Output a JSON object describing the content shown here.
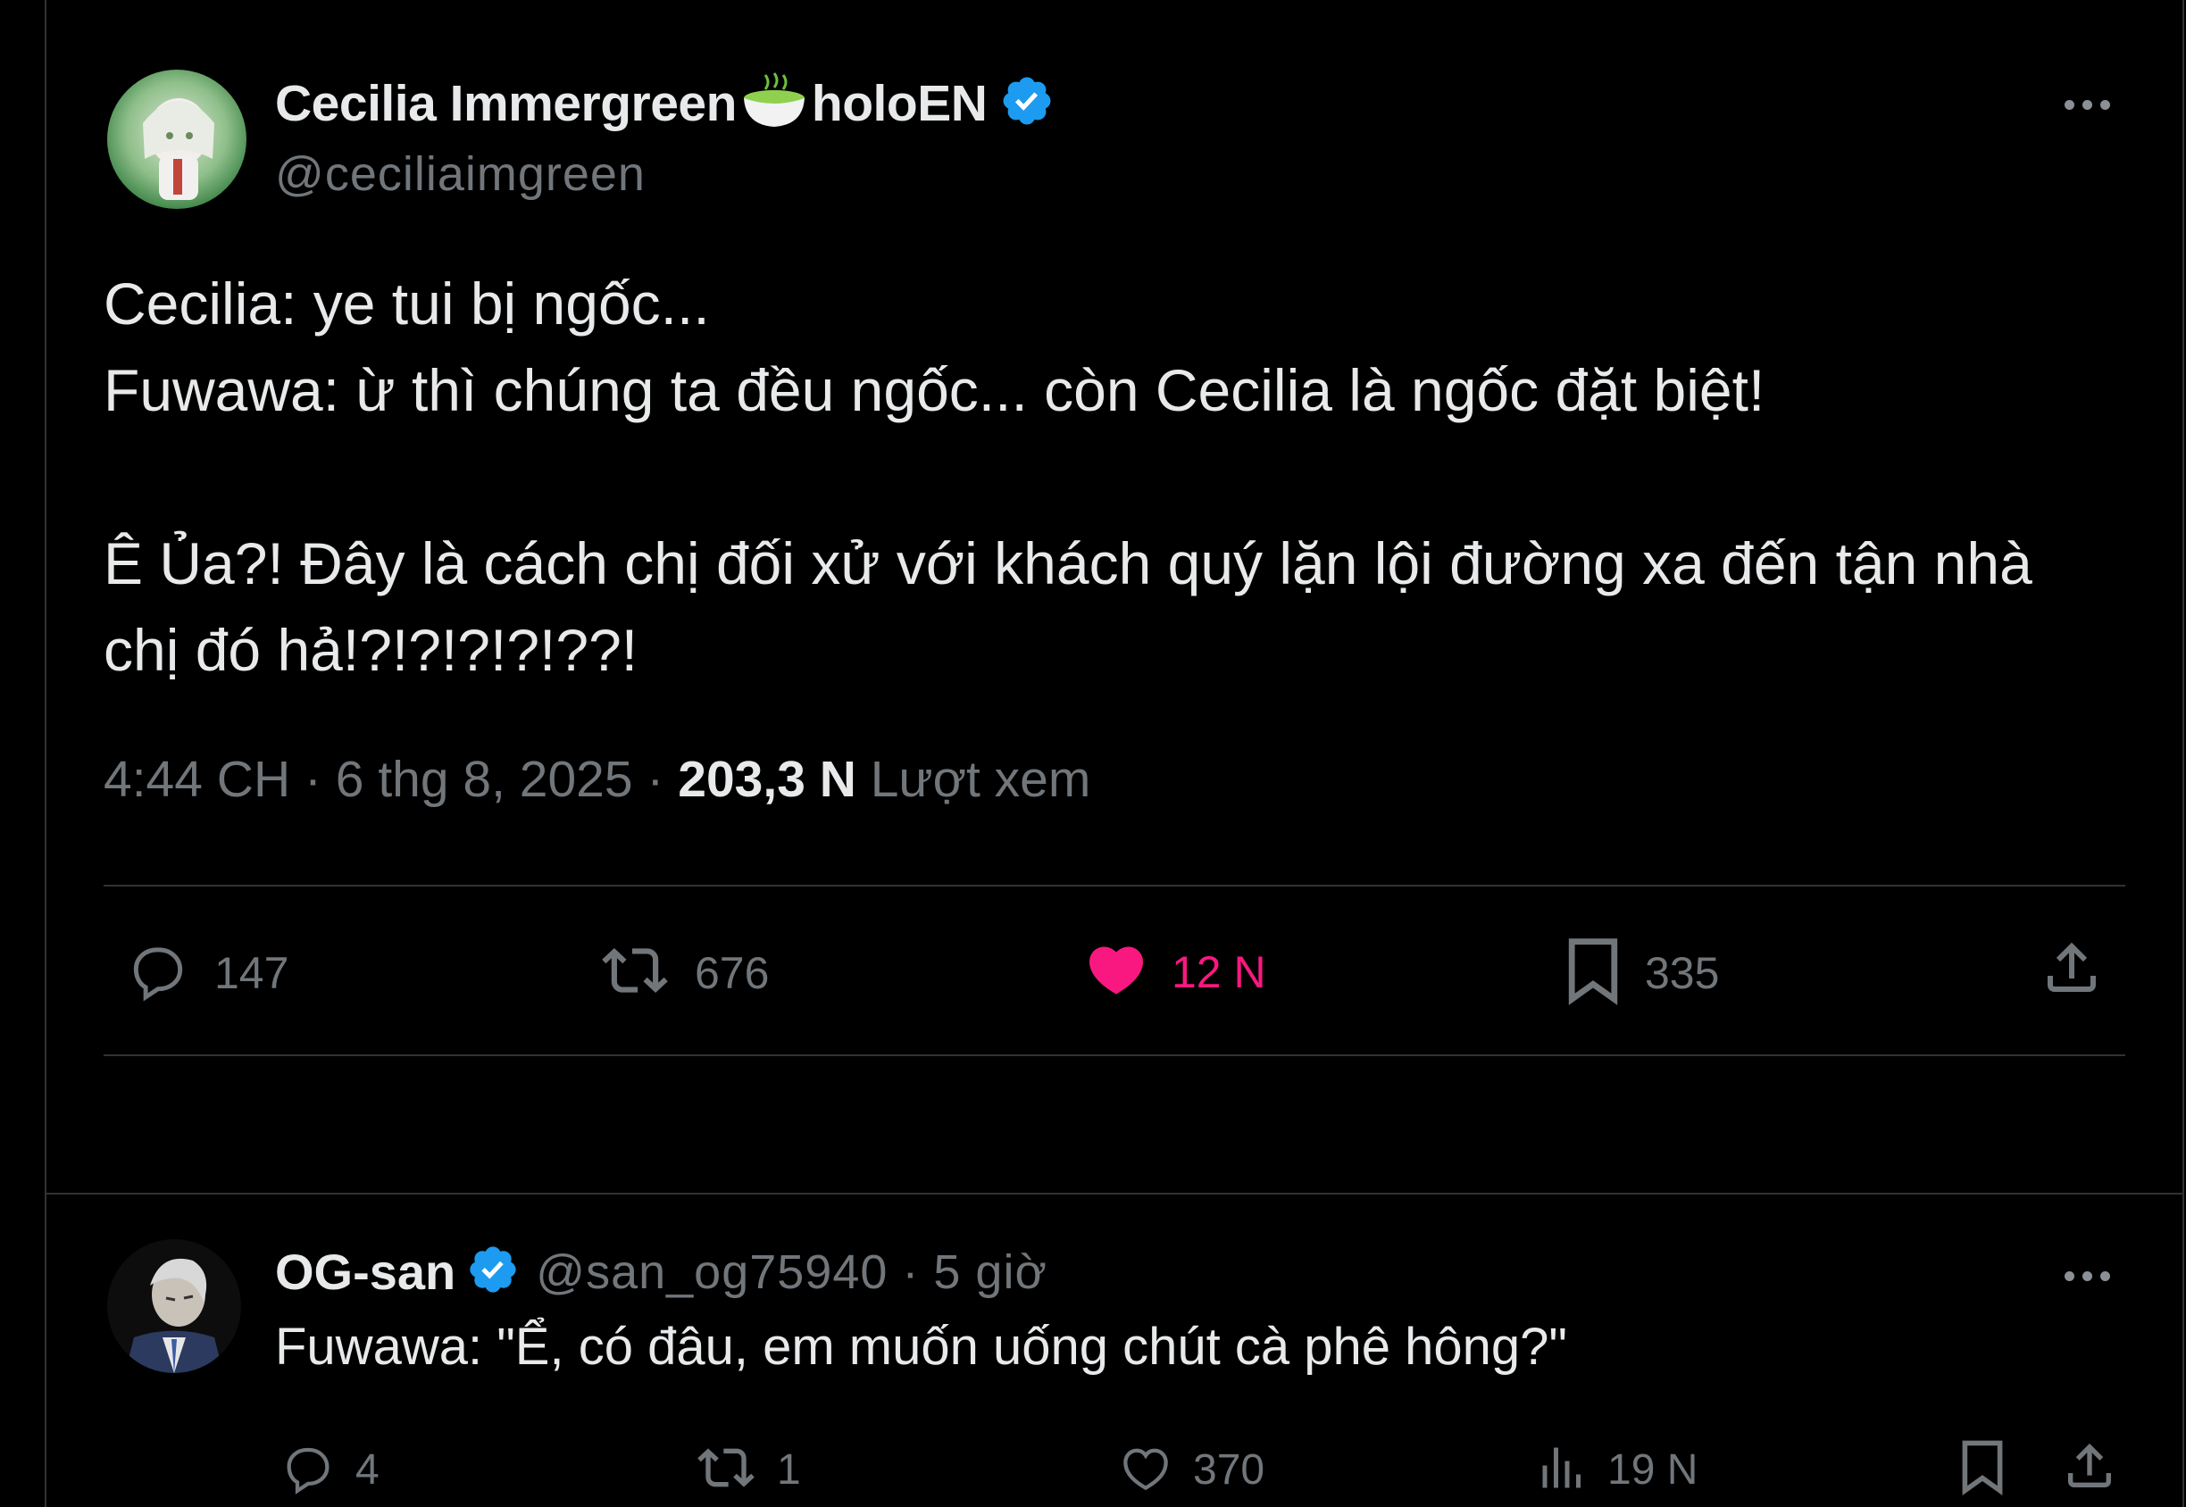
{
  "colors": {
    "background": "#000000",
    "text": "#e7e9ea",
    "muted": "#71767b",
    "divider": "#2f3336",
    "verified": "#1d9bf0",
    "like": "#f91880"
  },
  "main_tweet": {
    "author": {
      "display_name": "Cecilia Immergreen",
      "name_emoji_icon": "green-tea-bowl-icon",
      "display_name_suffix": "holoEN",
      "handle": "@ceciliaimgreen",
      "verified": true
    },
    "text_lines": [
      "Cecilia: ye tui bị ngốc...",
      "Fuwawa: ừ thì chúng ta đều ngốc... còn Cecilia là ngốc đặt biệt!",
      "",
      "Ê Ủa?! Đây là cách chị đối xử với khách quý lặn lội đường xa đến tận nhà",
      "chị đó hả!?!?!?!?!??!"
    ],
    "time": "4:44 CH",
    "date": "6 thg 8, 2025",
    "separator": "·",
    "views": "203,3 N",
    "views_label": "Lượt xem",
    "actions": {
      "replies": "147",
      "reposts": "676",
      "likes": "12 N",
      "bookmarks": "335"
    }
  },
  "reply": {
    "author": {
      "display_name": "OG-san",
      "verified": true,
      "handle": "@san_og75940",
      "time": "5 giờ"
    },
    "text": "Fuwawa: \"Ể, có đâu, em muốn uống chút cà phê hông?\"",
    "actions": {
      "replies": "4",
      "reposts": "1",
      "likes": "370",
      "views": "19 N"
    }
  }
}
